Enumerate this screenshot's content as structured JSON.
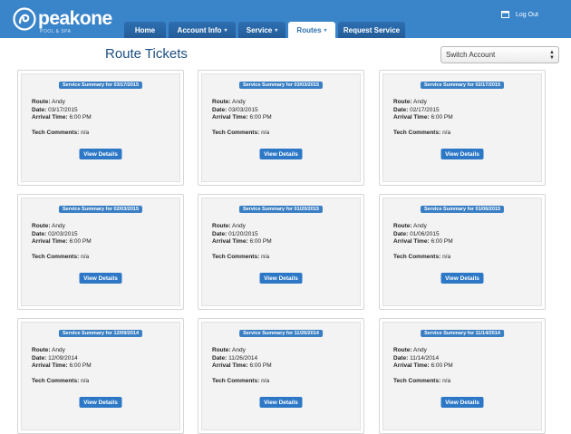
{
  "brand": {
    "name": "peakone",
    "tagline": "POOL & SPA"
  },
  "nav": {
    "tabs": [
      {
        "label": "Home",
        "caret": ""
      },
      {
        "label": "Account Info",
        "caret": "▾"
      },
      {
        "label": "Service",
        "caret": "▾"
      },
      {
        "label": "Routes",
        "caret": "▾",
        "active": true
      },
      {
        "label": "Request Service",
        "caret": ""
      }
    ]
  },
  "header": {
    "logout_label": "Log Out"
  },
  "page": {
    "title": "Route Tickets"
  },
  "account_switch": {
    "selected": "Switch Account"
  },
  "labels": {
    "route": "Route:",
    "date": "Date:",
    "arrival": "Arrival Time:",
    "comments": "Tech Comments:",
    "details_button": "View Details"
  },
  "tickets": [
    {
      "title": "Service Summary for 03/17/2015",
      "route": "Andy",
      "date": "03/17/2015",
      "arrival": "6:00 PM",
      "comments": "n/a"
    },
    {
      "title": "Service Summary for 03/03/2015",
      "route": "Andy",
      "date": "03/03/2015",
      "arrival": "6:00 PM",
      "comments": "n/a"
    },
    {
      "title": "Service Summary for 02/17/2015",
      "route": "Andy",
      "date": "02/17/2015",
      "arrival": "6:00 PM",
      "comments": "n/a"
    },
    {
      "title": "Service Summary for 02/03/2015",
      "route": "Andy",
      "date": "02/03/2015",
      "arrival": "6:00 PM",
      "comments": "n/a"
    },
    {
      "title": "Service Summary for 01/20/2015",
      "route": "Andy",
      "date": "01/20/2015",
      "arrival": "6:00 PM",
      "comments": "n/a"
    },
    {
      "title": "Service Summary for 01/06/2015",
      "route": "Andy",
      "date": "01/06/2015",
      "arrival": "6:00 PM",
      "comments": "n/a"
    },
    {
      "title": "Service Summary for 12/09/2014",
      "route": "Andy",
      "date": "12/09/2014",
      "arrival": "6:00 PM",
      "comments": "n/a"
    },
    {
      "title": "Service Summary for 11/26/2014",
      "route": "Andy",
      "date": "11/26/2014",
      "arrival": "6:00 PM",
      "comments": "n/a"
    },
    {
      "title": "Service Summary for 11/14/2014",
      "route": "Andy",
      "date": "11/14/2014",
      "arrival": "6:00 PM",
      "comments": "n/a"
    }
  ],
  "colors": {
    "header_bg": "#3a84c9",
    "button_bg": "#2d78c6",
    "title": "#1e4f84"
  }
}
